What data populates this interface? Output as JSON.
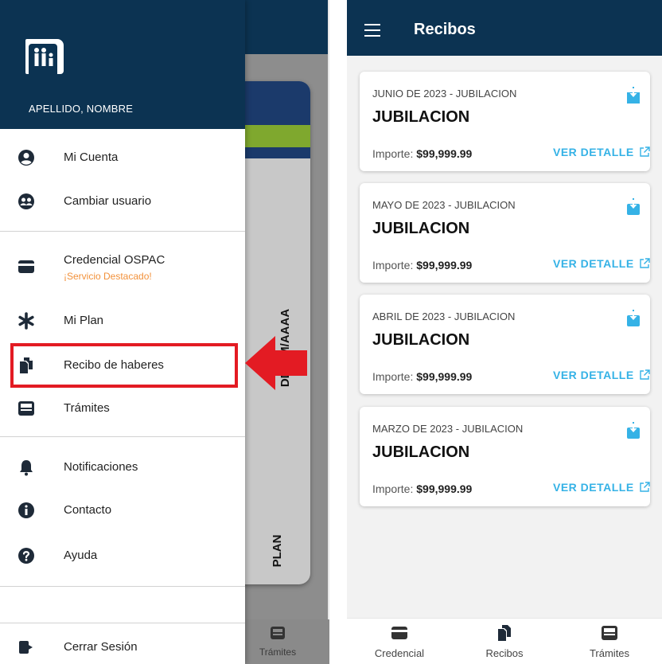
{
  "left_screen": {
    "user_name": "APELLIDO, NOMBRE",
    "background_card": {
      "date_text": "DD/MM/AAAA",
      "plan_text": "PLAN"
    },
    "background_nav_label": "Trámites",
    "menu": [
      {
        "label": "Mi Cuenta",
        "icon": "account-circle-icon"
      },
      {
        "label": "Cambiar usuario",
        "icon": "switch-user-icon"
      },
      {
        "label": "Credencial OSPAC",
        "sublabel": "¡Servicio Destacado!",
        "icon": "credit-card-icon"
      },
      {
        "label": "Mi Plan",
        "icon": "asterisk-icon"
      },
      {
        "label": "Recibo de haberes",
        "icon": "documents-icon"
      },
      {
        "label": "Trámites",
        "icon": "inbox-icon"
      },
      {
        "label": "Notificaciones",
        "icon": "bell-icon"
      },
      {
        "label": "Contacto",
        "icon": "info-icon"
      },
      {
        "label": "Ayuda",
        "icon": "help-icon"
      },
      {
        "label": "Cerrar Sesión",
        "icon": "logout-icon"
      }
    ],
    "colors": {
      "header": "#0c3352",
      "highlight": "#e31b23",
      "featured": "#f2913a"
    }
  },
  "right_screen": {
    "title": "Recibos",
    "receipts": [
      {
        "period": "JUNIO DE 2023 - JUBILACION",
        "title": "JUBILACION",
        "amount_label": "Importe:",
        "amount": "$99,999.99",
        "action": "VER DETALLE"
      },
      {
        "period": "MAYO DE 2023 - JUBILACION",
        "title": "JUBILACION",
        "amount_label": "Importe:",
        "amount": "$99,999.99",
        "action": "VER DETALLE"
      },
      {
        "period": "ABRIL DE 2023 - JUBILACION",
        "title": "JUBILACION",
        "amount_label": "Importe:",
        "amount": "$99,999.99",
        "action": "VER DETALLE"
      },
      {
        "period": "MARZO DE 2023 - JUBILACION",
        "title": "JUBILACION",
        "amount_label": "Importe:",
        "amount": "$99,999.99",
        "action": "VER DETALLE"
      }
    ],
    "bottom_nav": [
      {
        "label": "Credencial",
        "icon": "credit-card-icon"
      },
      {
        "label": "Recibos",
        "icon": "documents-icon",
        "active": true
      },
      {
        "label": "Trámites",
        "icon": "inbox-icon"
      }
    ],
    "colors": {
      "appbar": "#0c3352",
      "accent": "#35b2e6"
    }
  }
}
